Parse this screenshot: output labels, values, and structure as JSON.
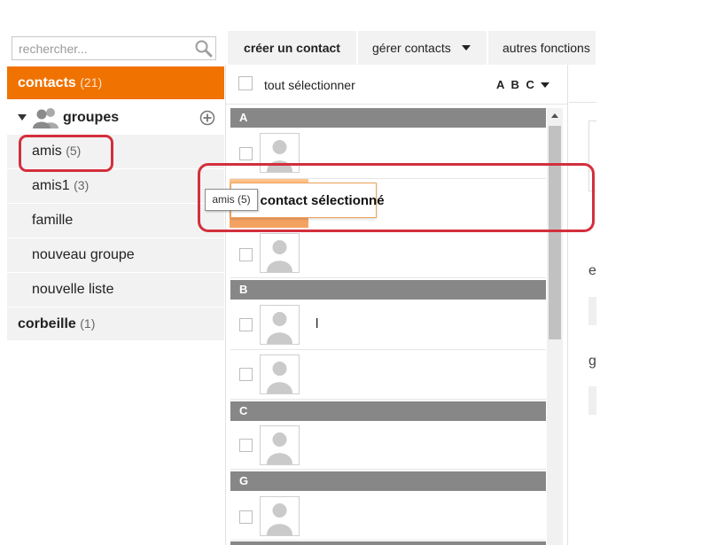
{
  "search": {
    "placeholder": "rechercher..."
  },
  "sidebar": {
    "contacts": {
      "label": "contacts",
      "count": "(21)"
    },
    "groupes": {
      "label": "groupes"
    },
    "groups": [
      {
        "label": "amis",
        "count": "(5)"
      },
      {
        "label": "amis1",
        "count": "(3)"
      },
      {
        "label": "famille",
        "count": ""
      },
      {
        "label": "nouveau groupe",
        "count": ""
      },
      {
        "label": "nouvelle liste",
        "count": ""
      }
    ],
    "corbeille": {
      "label": "corbeille",
      "count": "(1)"
    }
  },
  "toolbar": {
    "create_label": "créer un contact",
    "manage_label": "gérer contacts",
    "more_label": "autres fonctions"
  },
  "list": {
    "select_all_label": "tout sélectionner",
    "sort_label": "A B C",
    "sections": [
      "A",
      "B",
      "C",
      "G"
    ],
    "contact_names": [
      "",
      "",
      "",
      "l",
      "",
      "",
      ""
    ]
  },
  "drag": {
    "label": "1 contact sélectionné",
    "tooltip": "amis (5)"
  },
  "detail": {
    "letters": [
      "e",
      "g"
    ]
  },
  "colors": {
    "accent": "#f07200",
    "highlight_ring": "#d32f3c",
    "section_bar": "#878787",
    "sidebar_bg": "#f2f2f2"
  }
}
